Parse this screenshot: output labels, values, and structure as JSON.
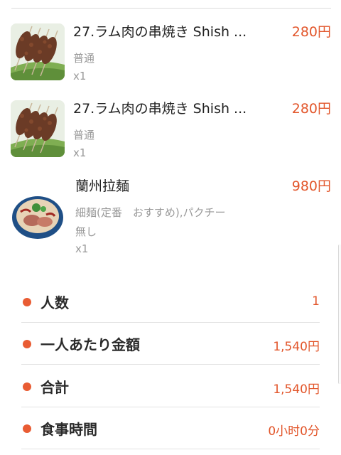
{
  "order_items": [
    {
      "name": "27.ラム肉の串焼き Shish ...",
      "price": "280円",
      "option": "普通",
      "quantity": "x1",
      "image": "lamb-skewers-image"
    },
    {
      "name": "27.ラム肉の串焼き Shish ...",
      "price": "280円",
      "option": "普通",
      "quantity": "x1",
      "image": "lamb-skewers-image"
    },
    {
      "name": "蘭州拉麺",
      "price": "980円",
      "option_lines": [
        "細麺(定番　おすすめ),パクチー",
        "無し"
      ],
      "quantity": "x1",
      "image": "ramen-bowl-image"
    }
  ],
  "summary": {
    "accent_color": "#e95c33",
    "people": {
      "label": "人数",
      "value": "1"
    },
    "per_person": {
      "label": "一人あたり金額",
      "value": "1,540円"
    },
    "total": {
      "label": "合計",
      "value": "1,540円"
    },
    "meal_time": {
      "label": "食事時間",
      "value": "0小时0分"
    }
  }
}
